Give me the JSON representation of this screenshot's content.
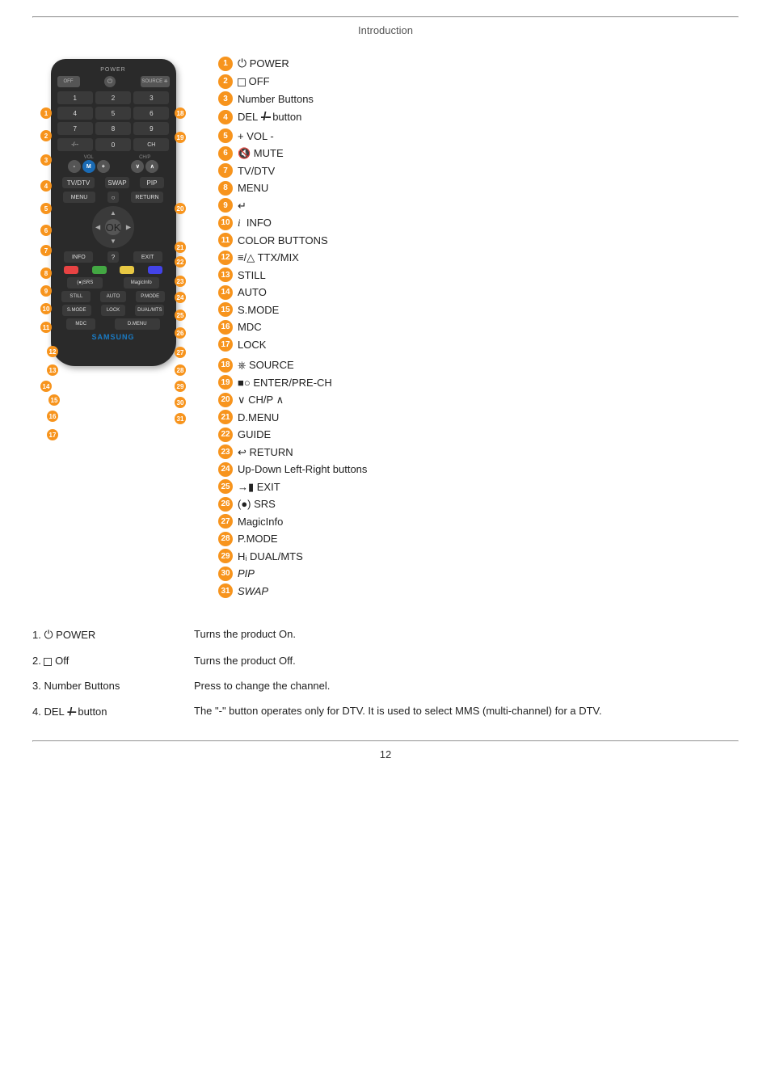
{
  "page": {
    "title": "Introduction",
    "page_number": "12"
  },
  "legend": [
    {
      "num": "1",
      "text": " POWER",
      "icon": "⏻",
      "italic": false
    },
    {
      "num": "2",
      "text": " OFF",
      "icon": "□",
      "italic": false
    },
    {
      "num": "3",
      "text": "Number Buttons",
      "icon": "",
      "italic": false
    },
    {
      "num": "4",
      "text": "DEL ",
      "icon": "⁻/⁻⁻",
      "suffix": " button",
      "italic": false
    },
    {
      "num": "5",
      "text": "+ VOL -",
      "icon": "",
      "italic": false
    },
    {
      "num": "6",
      "text": " MUTE",
      "icon": "🔇",
      "italic": false
    },
    {
      "num": "7",
      "text": "TV/DTV",
      "icon": "",
      "italic": false
    },
    {
      "num": "8",
      "text": "MENU",
      "icon": "",
      "italic": false
    },
    {
      "num": "9",
      "text": "↵",
      "icon": "",
      "italic": false
    },
    {
      "num": "10",
      "text": "  INFO",
      "icon": "i",
      "italic": false
    },
    {
      "num": "11",
      "text": "COLOR BUTTONS",
      "icon": "",
      "italic": false
    },
    {
      "num": "12",
      "text": " TTX/MIX",
      "icon": "≡/△",
      "italic": false
    },
    {
      "num": "13",
      "text": "STILL",
      "icon": "",
      "italic": false
    },
    {
      "num": "14",
      "text": "AUTO",
      "icon": "",
      "italic": false
    },
    {
      "num": "15",
      "text": "S.MODE",
      "icon": "",
      "italic": false
    },
    {
      "num": "16",
      "text": "MDC",
      "icon": "",
      "italic": false
    },
    {
      "num": "17",
      "text": "LOCK",
      "icon": "",
      "italic": false
    },
    {
      "num": "18",
      "text": " SOURCE",
      "icon": "⎈",
      "italic": false
    },
    {
      "num": "19",
      "text": " ENTER/PRE-CH",
      "icon": "⊡",
      "italic": false
    },
    {
      "num": "20",
      "text": "∨ CH/P ∧",
      "icon": "",
      "italic": false
    },
    {
      "num": "21",
      "text": "D.MENU",
      "icon": "",
      "italic": false
    },
    {
      "num": "22",
      "text": "GUIDE",
      "icon": "",
      "italic": false
    },
    {
      "num": "23",
      "text": " RETURN",
      "icon": "↩",
      "italic": false
    },
    {
      "num": "24",
      "text": "Up-Down Left-Right buttons",
      "icon": "",
      "italic": false
    },
    {
      "num": "25",
      "text": " EXIT",
      "icon": "→■",
      "italic": false
    },
    {
      "num": "26",
      "text": "(●) SRS",
      "icon": "",
      "italic": false
    },
    {
      "num": "27",
      "text": "MagicInfo",
      "icon": "",
      "italic": false
    },
    {
      "num": "28",
      "text": "P.MODE",
      "icon": "",
      "italic": false
    },
    {
      "num": "29",
      "text": " DUAL/MTS",
      "icon": "H",
      "italic": false
    },
    {
      "num": "30",
      "text": "PIP",
      "icon": "",
      "italic": true
    },
    {
      "num": "31",
      "text": "SWAP",
      "icon": "",
      "italic": true
    }
  ],
  "descriptions": [
    {
      "label": "1.  POWER",
      "label_icon": "⏻",
      "text": "Turns the product On."
    },
    {
      "label": "2.  Off",
      "label_icon": "□",
      "text": "Turns the product Off."
    },
    {
      "label": "3. Number Buttons",
      "label_icon": "",
      "text": "Press to change the channel."
    },
    {
      "label": "4. DEL -/-- button",
      "label_icon": "",
      "text": "The \"-\" button operates only for DTV. It is used to select MMS (multi-channel) for a DTV."
    }
  ],
  "remote": {
    "label_power": "POWER",
    "label_off": "OFF",
    "label_source": "SOURCE",
    "label_samsung": "SAMSUNG",
    "numbers": [
      "1",
      "2",
      "3",
      "4",
      "5",
      "6",
      "7",
      "8",
      "9",
      "-",
      "0",
      "CH"
    ]
  }
}
